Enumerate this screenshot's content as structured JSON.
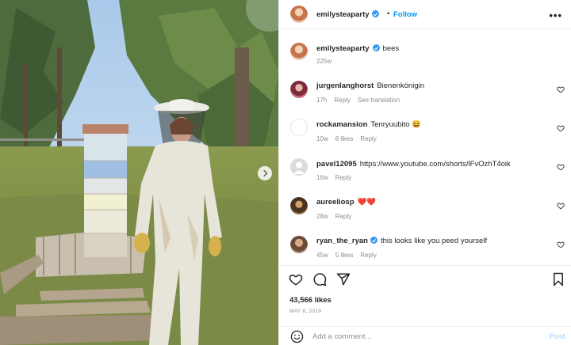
{
  "post": {
    "author": "emilysteaparty",
    "verified": true,
    "follow_separator": "•",
    "follow_label": "Follow",
    "more_icon": "more-horizontal-icon",
    "caption": {
      "username": "emilysteaparty",
      "text": "bees",
      "time": "225w"
    },
    "photo_description_icon": "photo",
    "carousel_next_icon": "chevron-right-icon"
  },
  "comments": [
    {
      "username": "jurgenlanghorst",
      "text": "Bienenkönigin",
      "time": "17h",
      "likes": "",
      "reply": "Reply",
      "extra": "See translation"
    },
    {
      "username": "rockamansion",
      "text": "Tenryuubito 😆",
      "time": "10w",
      "likes": "6 likes",
      "reply": "Reply",
      "extra": ""
    },
    {
      "username": "pavel12095",
      "text": "https://www.youtube.com/shorts/lFvOzhT4oik",
      "time": "16w",
      "likes": "",
      "reply": "Reply",
      "extra": ""
    },
    {
      "username": "aureeliosp",
      "text": "❤️❤️",
      "time": "28w",
      "likes": "",
      "reply": "Reply",
      "extra": ""
    },
    {
      "username": "ryan_the_ryan",
      "text": "this looks like you peed yourself",
      "time": "45w",
      "likes": "5 likes",
      "reply": "Reply",
      "extra": "",
      "verified": true
    }
  ],
  "actions": {
    "like_icon": "heart-icon",
    "comment_icon": "comment-icon",
    "share_icon": "share-icon",
    "save_icon": "bookmark-icon",
    "likes_count": "43,566 likes",
    "date": "MAY 8, 2019"
  },
  "add_comment": {
    "emoji_icon": "emoji-icon",
    "placeholder": "Add a comment...",
    "post_label": "Post"
  },
  "colors": {
    "accent": "#0095f6",
    "verified": "#3897f0",
    "muted": "#8e8e8e",
    "post_disabled": "#b3dbff"
  }
}
